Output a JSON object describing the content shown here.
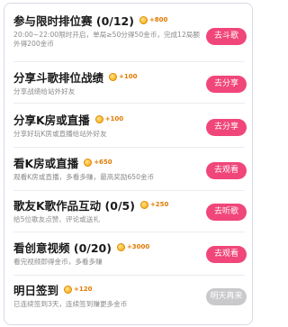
{
  "tasks": [
    {
      "title": "参与限时排位赛 (0/12)",
      "reward": "+800",
      "desc": "20:00~22:00限时开启，单局≥50分得50金币，完成12局额外得200金币",
      "button": "去斗歌",
      "enabled": true
    },
    {
      "title": "分享斗歌排位战绩",
      "reward": "+100",
      "desc": "分享战绩给站外好友",
      "button": "去分享",
      "enabled": true
    },
    {
      "title": "分享K房或直播",
      "reward": "+100",
      "desc": "分享好玩K房或直播给站外好友",
      "button": "去分享",
      "enabled": true
    },
    {
      "title": "看K房或直播",
      "reward": "+650",
      "desc": "观看K房或直播，多看多赚，最高奖励650金币",
      "button": "去观看",
      "enabled": true
    },
    {
      "title": "歌友K歌作品互动 (0/5)",
      "reward": "+250",
      "desc": "给5位歌友点赞、评论或送礼",
      "button": "去听歌",
      "enabled": true
    },
    {
      "title": "看创意视频 (0/20)",
      "reward": "+3000",
      "desc": "看完视频即得金币，多看多赚",
      "button": "去观看",
      "enabled": true
    },
    {
      "title": "明日签到",
      "reward": "+120",
      "desc": "已连续签到3天，连续签到赚更多金币",
      "button": "明天再来",
      "enabled": false
    }
  ]
}
